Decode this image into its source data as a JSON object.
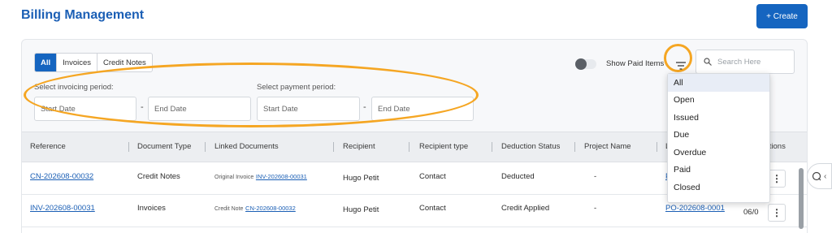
{
  "header": {
    "title": "Billing Management",
    "create_label": "+ Create"
  },
  "tabs": [
    {
      "label": "All",
      "active": true
    },
    {
      "label": "Invoices",
      "active": false
    },
    {
      "label": "Credit Notes",
      "active": false
    }
  ],
  "invoicing_period": {
    "label": "Select invoicing period:",
    "start_placeholder": "Start Date",
    "end_placeholder": "End Date",
    "separator": "-"
  },
  "payment_period": {
    "label": "Select payment period:",
    "start_placeholder": "Start Date",
    "end_placeholder": "End Date",
    "separator": "-"
  },
  "toggle": {
    "label": "Show Paid Items",
    "on": false
  },
  "filter": {
    "icon": "filter-icon"
  },
  "search": {
    "placeholder": "Search Here",
    "icon": "search-icon"
  },
  "columns": [
    "Reference",
    "Document Type",
    "Linked Documents",
    "Recipient",
    "Recipient type",
    "Deduction Status",
    "Project Name",
    "L",
    "ctions"
  ],
  "rows": [
    {
      "reference": "CN-202608-00032",
      "document_type": "Credit Notes",
      "linked_prefix": "Original Invoice",
      "linked_doc": "INV-202608-00031",
      "recipient": "Hugo Petit",
      "recipient_type": "Contact",
      "deduction_status": "Deducted",
      "project_name": "-",
      "linked_po": "P",
      "date": ""
    },
    {
      "reference": "INV-202608-00031",
      "document_type": "Invoices",
      "linked_prefix": "Credit Note",
      "linked_doc": "CN-202608-00032",
      "recipient": "Hugo Petit",
      "recipient_type": "Contact",
      "deduction_status": "Credit Applied",
      "project_name": "-",
      "linked_po": "PO-202608-0001",
      "date": "06/0"
    }
  ],
  "dropdown": {
    "options": [
      "All",
      "Open",
      "Issued",
      "Due",
      "Overdue",
      "Paid",
      "Closed"
    ],
    "selected": "All"
  },
  "kebab_glyph": "⋮",
  "side_tab_glyph": "‹",
  "colors": {
    "accent": "#1565c0",
    "highlight": "#f5a623"
  }
}
